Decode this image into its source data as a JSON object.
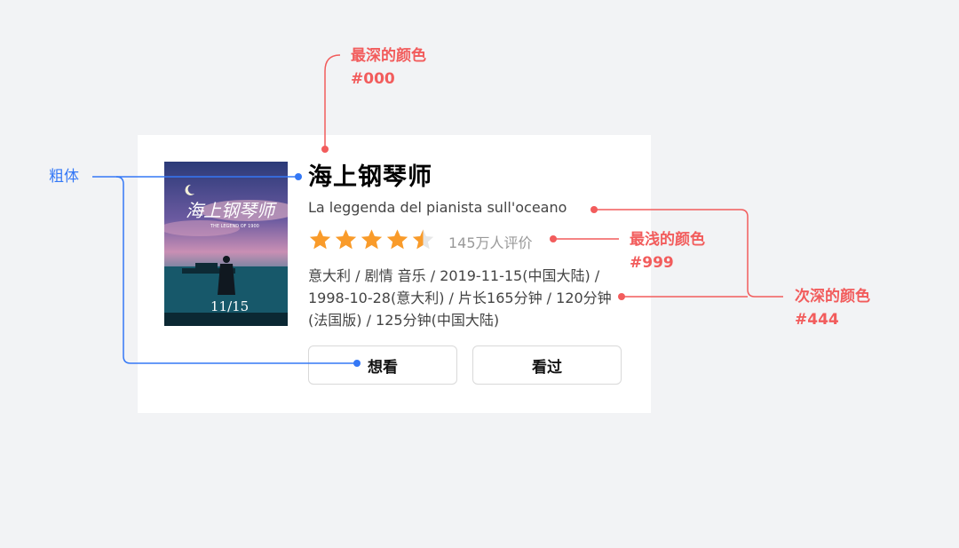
{
  "movie": {
    "title": "海上钢琴师",
    "original_title": "La leggenda del pianista sull'oceano",
    "rating": 4.5,
    "rating_max": 5,
    "rating_count": "145万人评价",
    "meta": "意大利 / 剧情 音乐 / 2019-11-15(中国大陆) / 1998-10-28(意大利) / 片长165分钟 / 120分钟(法国版) / 125分钟(中国大陆)",
    "poster": {
      "title_text": "海上钢琴师",
      "date_text": "11/15",
      "sub_text": "THE LEGEND OF 1900"
    }
  },
  "actions": {
    "want": "想看",
    "seen": "看过"
  },
  "annotations": {
    "darkest_label": "最深的颜色",
    "darkest_value": "#000",
    "bold_label": "粗体",
    "lightest_label": "最浅的颜色",
    "lightest_value": "#999",
    "second_label": "次深的颜色",
    "second_value": "#444"
  },
  "colors": {
    "annotation_red": "#f25c5c",
    "annotation_blue": "#3478f6",
    "star": "#f99b2a",
    "star_empty": "#e6e6e6"
  }
}
